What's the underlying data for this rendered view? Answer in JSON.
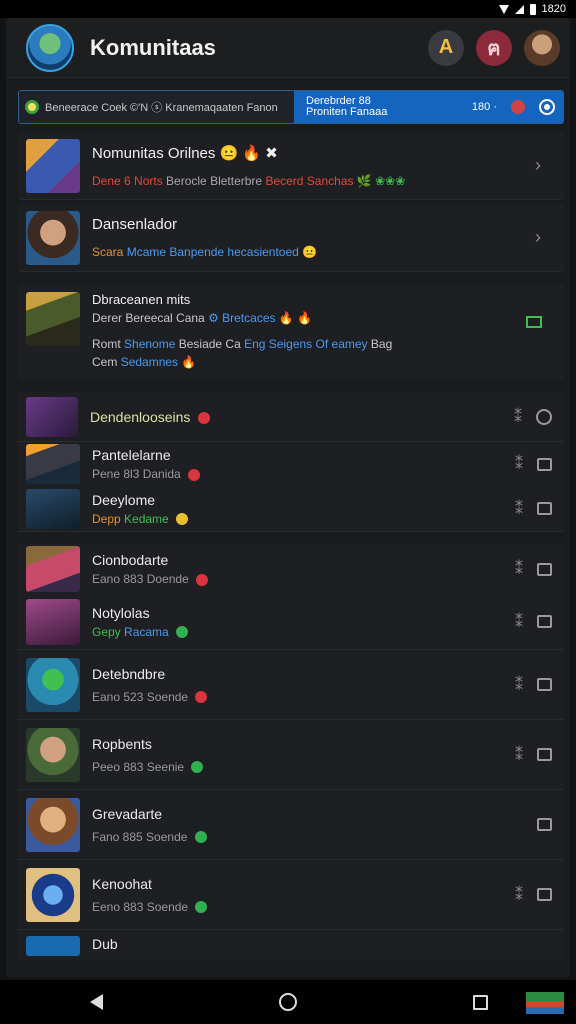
{
  "statusbar": {
    "time": "1820"
  },
  "header": {
    "title": "Komunitaas",
    "btn_a_label": "A",
    "btn_b_label": "ฅ"
  },
  "banner": {
    "left_text": "Beneerace Coek ©'N ⓢ Kranemaqaaten Fanon",
    "right_line1": "Derebrder 88",
    "right_line2": "Proniten Fanaaa",
    "rate": "180 ·"
  },
  "cards": [
    {
      "title": "Nomunitas Orilnes 😐 🔥 ✖",
      "sub_a": "Dene 6 Norts",
      "sub_b": "Berocle Bletterbre",
      "sub_c": "Becerd Sanchas",
      "sub_d": "🌿 ❀❀❀"
    },
    {
      "title": "Dansenlador",
      "sub_a": "Scara",
      "sub_b": "Mcame Banpende hecasientoed",
      "sub_c": "😐"
    }
  ],
  "big_card": {
    "title": "Dbraceanen mits",
    "line2_a": "Derer Bereecal Cana",
    "line2_b": "⚙ Bretcaces 🔥 🔥",
    "line3_a": "Romt",
    "line3_b": "Shenome",
    "line3_c": "Besiade Ca",
    "line3_d": "Eng Seigens",
    "line3_e": "Of eamey",
    "line3_f": "Bag",
    "line4_a": "Cem",
    "line4_b": "Sedamnes",
    "line4_c": "🔥"
  },
  "group1": [
    {
      "name": "Dendenlooseins",
      "sub": "",
      "badge": "r"
    },
    {
      "name": "Pantelelarne",
      "sub": "Pene 8l3 Danida",
      "badge": "r"
    },
    {
      "name": "Deeylome",
      "sub_a": "Depp",
      "sub_b": "Kedame",
      "badge": "y"
    }
  ],
  "group2": [
    {
      "name": "Cionbodarte",
      "sub": "Eano 883 Doende",
      "badge": "r"
    },
    {
      "name": "Notylolas",
      "sub_a": "Gepy",
      "sub_b": "Racama",
      "badge": "g"
    },
    {
      "name": "Detebndbre",
      "sub": "Eano 523 Soende",
      "badge": "r"
    },
    {
      "name": "Ropbents",
      "sub": "Peeo 883 Seenie",
      "badge": "g"
    },
    {
      "name": "Grevadarte",
      "sub": "Fano 885 Soende",
      "badge": "g"
    },
    {
      "name": "Kenoohat",
      "sub": "Eeno 883 Soende",
      "badge": "g"
    }
  ],
  "partial": {
    "name": "Dub"
  }
}
